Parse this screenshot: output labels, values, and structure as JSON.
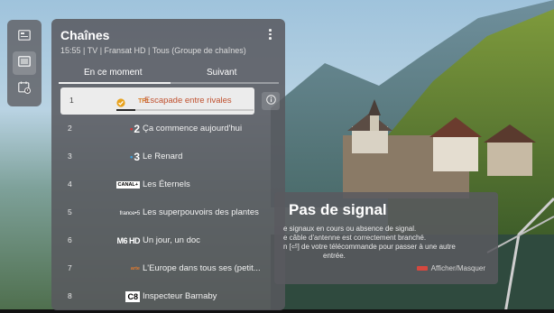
{
  "panel": {
    "title": "Chaînes",
    "subtitle": "15:55 | TV | Fransat HD | Tous (Groupe de chaînes)",
    "tabs": [
      {
        "label": "En ce moment",
        "selected": true
      },
      {
        "label": "Suivant",
        "selected": false
      }
    ]
  },
  "channels": [
    {
      "number": "1",
      "logo": "TF1",
      "program": "Escapade entre rivales",
      "progress": 0.14,
      "selected": true
    },
    {
      "number": "2",
      "logo": "2",
      "program": "Ça commence aujourd'hui",
      "selected": false
    },
    {
      "number": "3",
      "logo": "3",
      "program": "Le Renard",
      "selected": false
    },
    {
      "number": "4",
      "logo": "CANAL+",
      "program": "Les Éternels",
      "selected": false
    },
    {
      "number": "5",
      "logo": "france•5",
      "program": "Les superpouvoirs des plantes",
      "selected": false
    },
    {
      "number": "6",
      "logo": "M6 HD",
      "program": "Un jour, un doc",
      "selected": false
    },
    {
      "number": "7",
      "logo": "arte",
      "program": "L'Europe dans tous ses (petit...",
      "selected": false
    },
    {
      "number": "8",
      "logo": "C8",
      "program": "Inspecteur Barnaby",
      "selected": false
    }
  ],
  "dialog": {
    "title": "Pas de signal",
    "lines": [
      "e signaux en cours ou absence de signal.",
      "e câble d'antenne est correctement branché.",
      "n [⏎] de votre télécommande pour passer à une autre",
      "entrée."
    ],
    "hint": "Afficher/Masquer"
  },
  "icons": {
    "rail": [
      "guide-icon",
      "channel-list-icon",
      "schedule-icon"
    ],
    "info": "info-icon",
    "more": "more-vertical-icon",
    "check": "check-circle-icon"
  },
  "colors": {
    "accent_program": "#c0512f",
    "check": "#e8a21c",
    "hint_key": "#d4483f"
  }
}
